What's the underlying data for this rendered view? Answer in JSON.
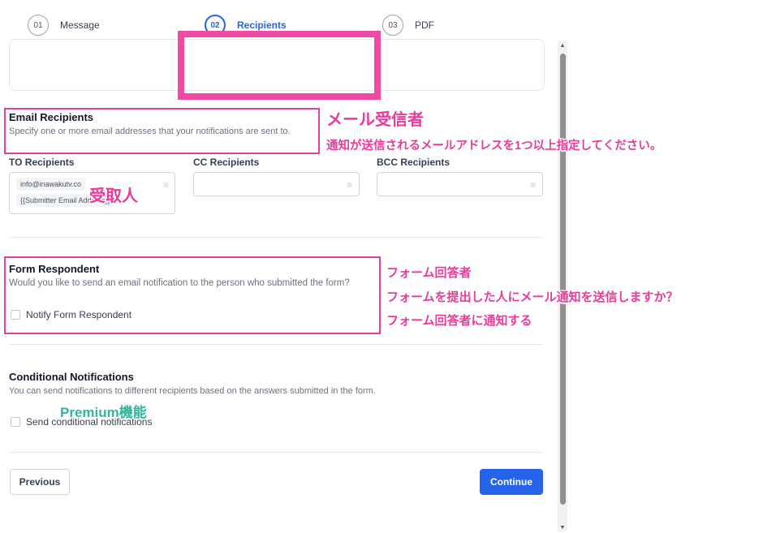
{
  "stepper": {
    "steps": [
      {
        "num": "01",
        "label": "Message"
      },
      {
        "num": "02",
        "label": "Recipients"
      },
      {
        "num": "03",
        "label": "PDF"
      }
    ]
  },
  "email_recipients": {
    "title": "Email Recipients",
    "description": "Specify one or more email addresses that your notifications are sent to.",
    "to_label": "TO Recipients",
    "cc_label": "CC Recipients",
    "bcc_label": "BCC Recipients",
    "to_chips": [
      "info@inawakutv.co",
      "{{Submitter Email Address}}"
    ]
  },
  "form_respondent": {
    "title": "Form Respondent",
    "description": "Would you like to send an email notification to the person who submitted the form?",
    "checkbox_label": "Notify Form Respondent"
  },
  "conditional": {
    "title": "Conditional Notifications",
    "description": "You can send notifications to different recipients based on the answers submitted in the form.",
    "checkbox_label": "Send conditional notifications"
  },
  "buttons": {
    "previous": "Previous",
    "continue": "Continue"
  },
  "annotations": {
    "email_title_jp": "メール受信者",
    "email_desc_jp": "通知が送信されるメールアドレスを1つ以上指定してください。",
    "to_jp": "受取人",
    "respondent_title_jp": "フォーム回答者",
    "respondent_desc_jp": "フォームを提出した人にメール通知を送信しますか？",
    "respondent_cb_jp": "フォーム回答者に通知する",
    "premium": "Premium機能"
  },
  "colors": {
    "accent": "#2563eb",
    "annotation": "#ec3a9a",
    "premium": "#2fb7a0"
  }
}
